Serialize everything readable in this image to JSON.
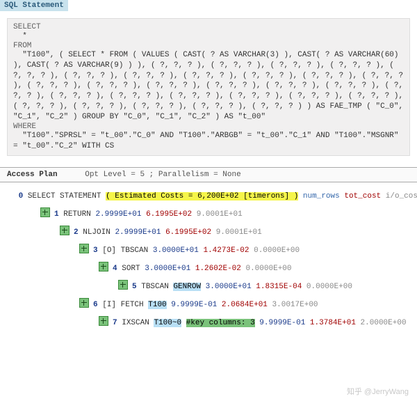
{
  "header": {
    "title": "SQL Statement"
  },
  "sql": {
    "select_kw": "SELECT",
    "select_body": "  *",
    "from_kw": "FROM",
    "from_body": "  \"T100\", ( SELECT * FROM ( VALUES ( CAST( ? AS VARCHAR(3) ), CAST( ? AS VARCHAR(60) ), CAST( ? AS VARCHAR(9) ) ), ( ?, ?, ? ), ( ?, ?, ? ), ( ?, ?, ? ), ( ?, ?, ? ), ( ?, ?, ? ), ( ?, ?, ? ), ( ?, ?, ? ), ( ?, ?, ? ), ( ?, ?, ? ), ( ?, ?, ? ), ( ?, ?, ? ), ( ?, ?, ? ), ( ?, ?, ? ), ( ?, ?, ? ), ( ?, ?, ? ), ( ?, ?, ? ), ( ?, ?, ? ), ( ?, ?, ? ), ( ?, ?, ? ), ( ?, ?, ? ), ( ?, ?, ? ), ( ?, ?, ? ), ( ?, ?, ? ), ( ?, ?, ? ), ( ?, ?, ? ), ( ?, ?, ? ), ( ?, ?, ? ), ( ?, ?, ? ), ( ?, ?, ? ) ) AS FAE_TMP ( \"C_0\", \"C_1\", \"C_2\" ) GROUP BY \"C_0\", \"C_1\", \"C_2\" ) AS \"t_00\"",
    "where_kw": "WHERE",
    "where_body": "  \"T100\".\"SPRSL\" = \"t_00\".\"C_0\" AND \"T100\".\"ARBGB\" = \"t_00\".\"C_1\" AND \"T100\".\"MSGNR\" = \"t_00\".\"C_2\" WITH CS"
  },
  "access": {
    "label": "Access Plan",
    "opt": "Opt Level = 5 ; Parallelism = None"
  },
  "plan": {
    "root_id": "0",
    "root_op": "SELECT STATEMENT",
    "root_cost": "( Estimated Costs =  6,200E+02 [timerons] )",
    "root_cols": {
      "a": "num_rows",
      "b": "tot_cost",
      "c": "i/o_cost"
    },
    "steps": [
      {
        "id": "1",
        "indent": 1,
        "op": "RETURN",
        "obj": "",
        "objhl": "",
        "extra": "",
        "extra_hl": "",
        "blue": "2.9999E+01",
        "red": "6.1995E+02",
        "gray": "9.0001E+01"
      },
      {
        "id": "2",
        "indent": 2,
        "op": "NLJOIN",
        "obj": "",
        "objhl": "",
        "extra": "",
        "extra_hl": "",
        "blue": "2.9999E+01",
        "red": "6.1995E+02",
        "gray": "9.0001E+01"
      },
      {
        "id": "3",
        "indent": 3,
        "op": "[O] TBSCAN",
        "obj": "",
        "objhl": "",
        "extra": "",
        "extra_hl": "",
        "blue": "3.0000E+01",
        "red": "1.4273E-02",
        "gray": "0.0000E+00"
      },
      {
        "id": "4",
        "indent": 4,
        "op": "SORT",
        "obj": "",
        "objhl": "",
        "extra": "",
        "extra_hl": "",
        "blue": "3.0000E+01",
        "red": "1.2602E-02",
        "gray": "0.0000E+00"
      },
      {
        "id": "5",
        "indent": 5,
        "op": "TBSCAN",
        "obj": "GENROW",
        "objhl": "blue",
        "extra": "",
        "extra_hl": "",
        "blue": "3.0000E+01",
        "red": "1.8315E-04",
        "gray": "0.0000E+00"
      },
      {
        "id": "6",
        "indent": 3,
        "op": "[I] FETCH",
        "obj": "T100",
        "objhl": "blue",
        "extra": "",
        "extra_hl": "",
        "blue": "9.9999E-01",
        "red": "2.0684E+01",
        "gray": "3.0017E+00"
      },
      {
        "id": "7",
        "indent": 4,
        "op": "IXSCAN",
        "obj": "T100~0",
        "objhl": "blue",
        "extra": "#key columns:  3",
        "extra_hl": "green",
        "blue": "9.9999E-01",
        "red": "1.3784E+01",
        "gray": "2.0000E+00"
      }
    ]
  },
  "watermark": "知乎 @JerryWang"
}
